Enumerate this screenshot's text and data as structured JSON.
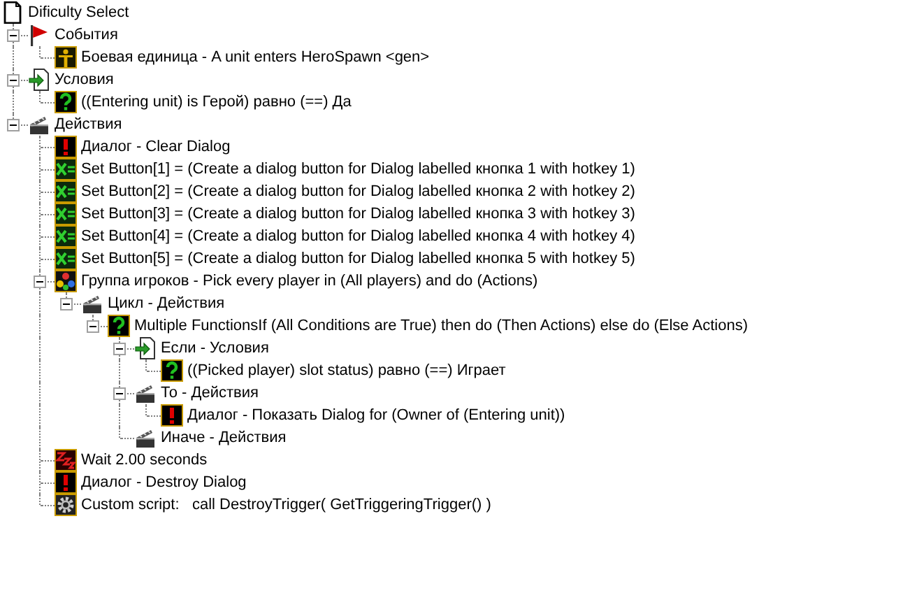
{
  "tree": {
    "label": "Dificulty Select",
    "kind": "trigger",
    "children": [
      {
        "label": "События",
        "kind": "events",
        "expanded": true,
        "children": [
          {
            "label": "Боевая единица - A unit enters HeroSpawn <gen>",
            "kind": "unit"
          }
        ]
      },
      {
        "label": "Условия",
        "kind": "conditions",
        "expanded": true,
        "children": [
          {
            "label": "((Entering unit) is Герой) равно (==) Да",
            "kind": "condition"
          }
        ]
      },
      {
        "label": "Действия",
        "kind": "actions",
        "expanded": true,
        "children": [
          {
            "label": "Диалог - Clear Dialog",
            "kind": "dialog"
          },
          {
            "label": "Set Button[1] = (Create a dialog button for Dialog labelled кнопка 1 with hotkey 1)",
            "kind": "set"
          },
          {
            "label": "Set Button[2] = (Create a dialog button for Dialog labelled кнопка 2 with hotkey 2)",
            "kind": "set"
          },
          {
            "label": "Set Button[3] = (Create a dialog button for Dialog labelled кнопка 3 with hotkey 3)",
            "kind": "set"
          },
          {
            "label": "Set Button[4] = (Create a dialog button for Dialog labelled кнопка 4 with hotkey 4)",
            "kind": "set"
          },
          {
            "label": "Set Button[5] = (Create a dialog button for Dialog labelled кнопка 5 with hotkey 5)",
            "kind": "set"
          },
          {
            "label": "Группа игроков - Pick every player in (All players) and do (Actions)",
            "kind": "players",
            "expanded": true,
            "children": [
              {
                "label": "Цикл - Действия",
                "kind": "actions",
                "expanded": true,
                "children": [
                  {
                    "label": "Multiple FunctionsIf (All Conditions are True) then do (Then Actions) else do (Else Actions)",
                    "kind": "condition",
                    "expanded": true,
                    "children": [
                      {
                        "label": "Если - Условия",
                        "kind": "conditions",
                        "expanded": true,
                        "children": [
                          {
                            "label": "((Picked player) slot status) равно (==) Играет",
                            "kind": "condition"
                          }
                        ]
                      },
                      {
                        "label": "То - Действия",
                        "kind": "actions",
                        "expanded": true,
                        "children": [
                          {
                            "label": "Диалог - Показать Dialog for (Owner of (Entering unit))",
                            "kind": "dialog"
                          }
                        ]
                      },
                      {
                        "label": "Иначе - Действия",
                        "kind": "actions"
                      }
                    ]
                  }
                ]
              }
            ]
          },
          {
            "label": "Wait 2.00 seconds",
            "kind": "wait"
          },
          {
            "label": "Диалог - Destroy Dialog",
            "kind": "dialog"
          },
          {
            "label": "Custom script:   call DestroyTrigger( GetTriggeringTrigger() )",
            "kind": "script"
          }
        ]
      }
    ]
  }
}
